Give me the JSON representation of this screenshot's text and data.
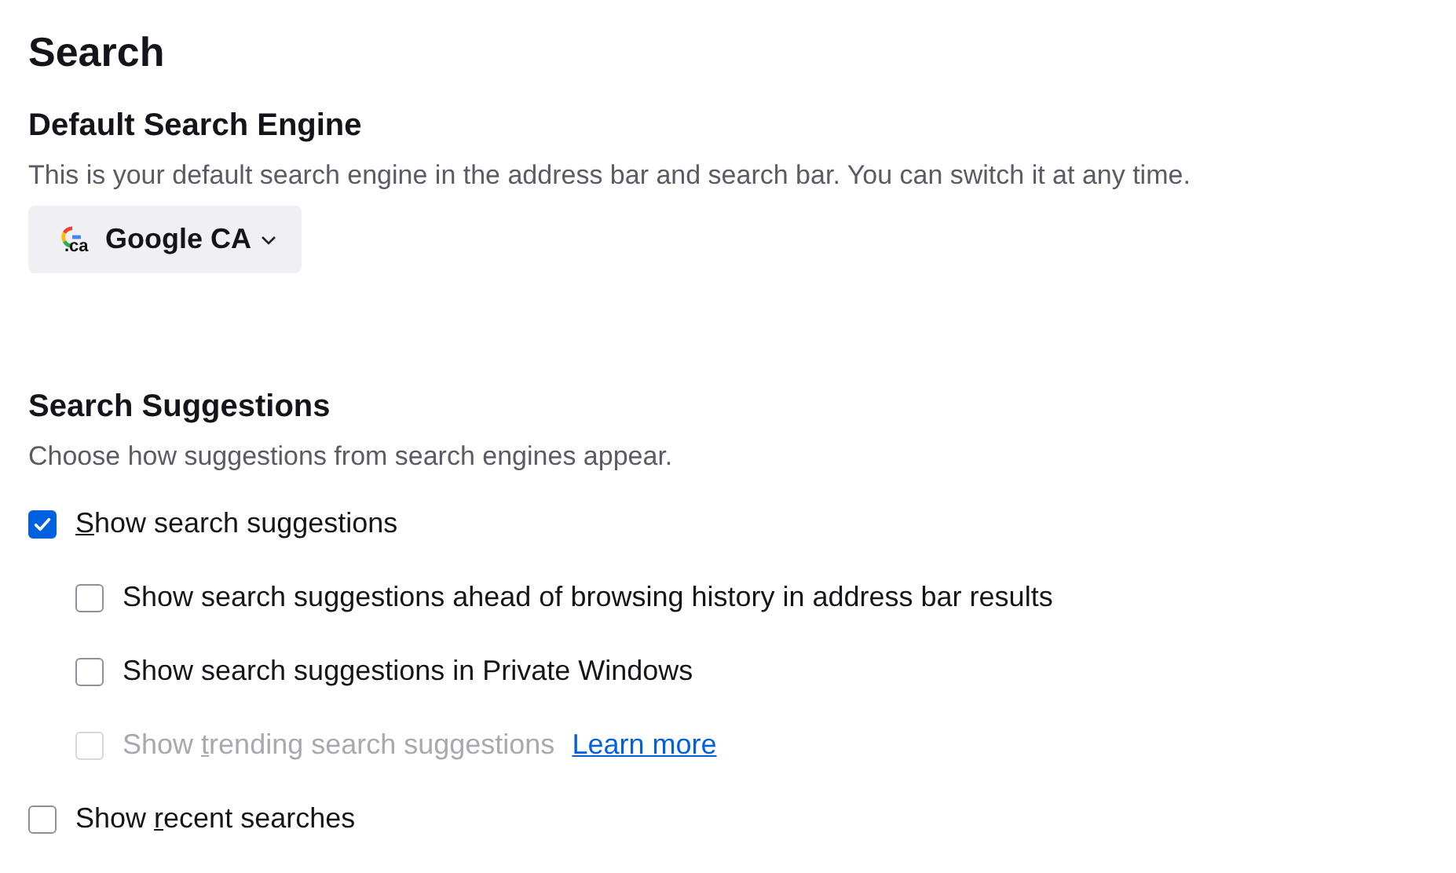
{
  "title": "Search",
  "sections": [
    {
      "heading": "Default Search Engine",
      "description": "This is your default search engine in the address bar and search bar. You can switch it at any time.",
      "engine": {
        "icon_text": ".ca",
        "label": "Google CA"
      }
    },
    {
      "heading": "Search Suggestions",
      "description": "Choose how suggestions from search engines appear.",
      "options": [
        {
          "key": "S",
          "after": "how search suggestions",
          "checked": true,
          "disabled": false,
          "children": [
            {
              "before": "Show search suggestions ahead of browsing history in address bar results",
              "checked": false,
              "disabled": false
            },
            {
              "before": "Show search suggestions in Private Windows",
              "checked": false,
              "disabled": false
            },
            {
              "before": "Show ",
              "key": "t",
              "after": "rending search suggestions",
              "checked": false,
              "disabled": true,
              "link": "Learn more"
            }
          ]
        },
        {
          "before": "Show ",
          "key": "r",
          "after": "ecent searches",
          "checked": false,
          "disabled": false
        }
      ]
    }
  ]
}
